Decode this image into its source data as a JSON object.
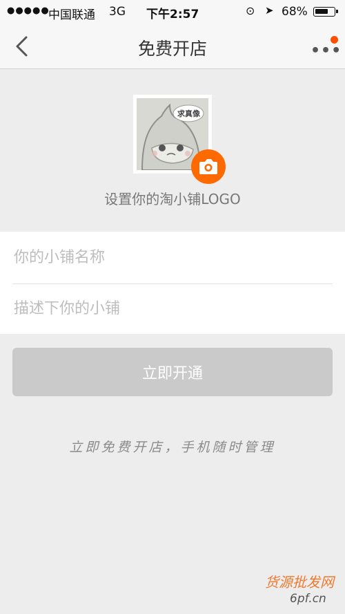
{
  "status_bar": {
    "signal": "●●●●●",
    "carrier": "中国联通",
    "network": "3G",
    "time": "下午2:57",
    "lock_icon": "rotation-lock-icon",
    "location_icon": "location-arrow-icon",
    "battery_percent": "68%",
    "battery_level": 0.68
  },
  "nav": {
    "title": "免费开店",
    "back_icon": "chevron-left-icon",
    "more_icon": "more-dots-icon",
    "badge_color": "#ff5000"
  },
  "logo": {
    "bubble_text": "求真像",
    "caption": "设置你的淘小铺LOGO",
    "camera_icon": "camera-icon",
    "accent": "#ff6a00"
  },
  "form": {
    "name_placeholder": "你的小铺名称",
    "desc_placeholder": "描述下你的小铺"
  },
  "submit_label": "立即开通",
  "tagline": "立即免费开店，手机随时管理",
  "watermark": {
    "text": "货源批发网",
    "url": "6pf.cn"
  }
}
